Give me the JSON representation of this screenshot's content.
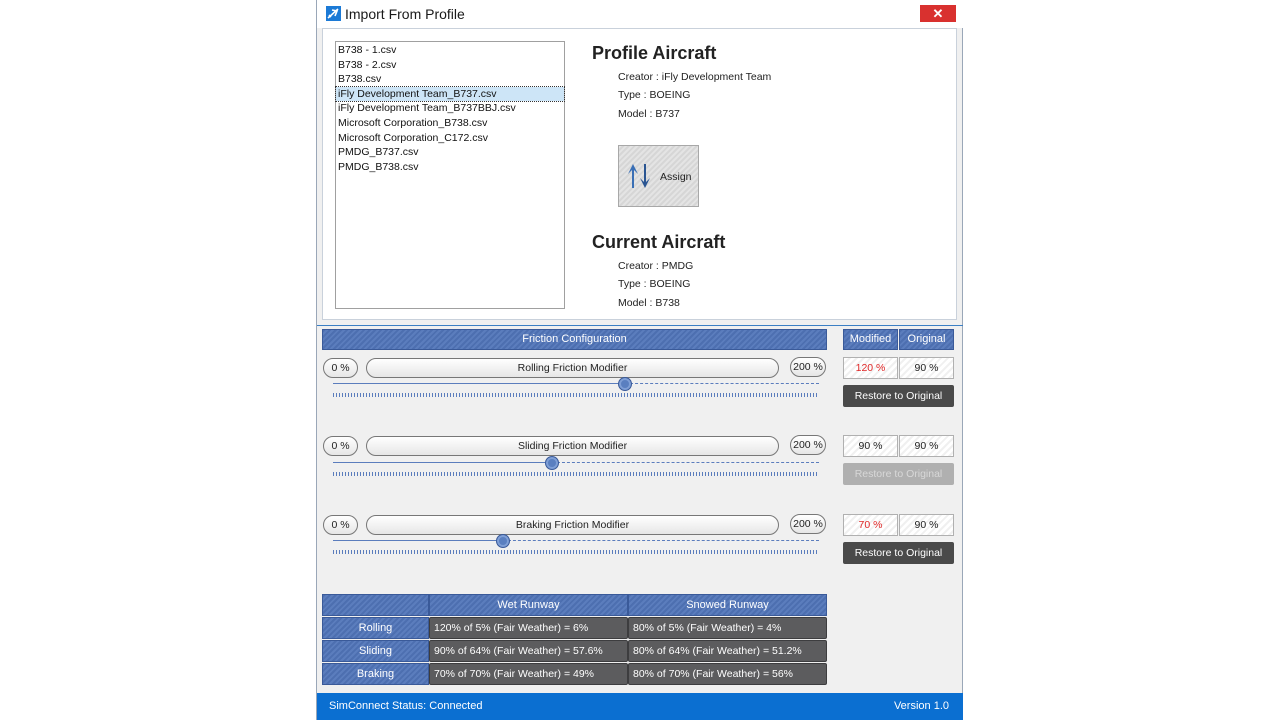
{
  "window": {
    "title": "Import From Profile",
    "close_label": "✕"
  },
  "file_list": {
    "items": [
      "B738 - 1.csv",
      "B738 - 2.csv",
      "B738.csv",
      "iFly Development Team_B737.csv",
      "iFly Development Team_B737BBJ.csv",
      "Microsoft Corporation_B738.csv",
      "Microsoft Corporation_C172.csv",
      "PMDG_B737.csv",
      "PMDG_B738.csv"
    ],
    "selected": 3
  },
  "profile_aircraft": {
    "title": "Profile Aircraft",
    "creator": "Creator : iFly Development Team",
    "type": "Type : BOEING",
    "model": "Model : B737"
  },
  "assign_button": {
    "label": "Assign"
  },
  "current_aircraft": {
    "title": "Current Aircraft",
    "creator": "Creator : PMDG",
    "type": "Type : BOEING",
    "model": "Model : B738"
  },
  "friction": {
    "header": "Friction Configuration",
    "col_modified": "Modified",
    "col_original": "Original",
    "min_label": "0 %",
    "max_label": "200 %",
    "restore_label": "Restore to Original",
    "rows": [
      {
        "label": "Rolling Friction Modifier",
        "modified": "120 %",
        "original": "90 %",
        "slider_percent": 120,
        "restore_enabled": true
      },
      {
        "label": "Sliding Friction Modifier",
        "modified": "90 %",
        "original": "90 %",
        "slider_percent": 90,
        "restore_enabled": false
      },
      {
        "label": "Braking Friction Modifier",
        "modified": "70 %",
        "original": "90 %",
        "slider_percent": 70,
        "restore_enabled": true
      }
    ]
  },
  "runway_table": {
    "headers": [
      "",
      "Wet Runway",
      "Snowed Runway"
    ],
    "rows": [
      {
        "label": "Rolling",
        "wet": "120% of 5% (Fair Weather) = 6%",
        "snow": "80% of 5% (Fair Weather) = 4%"
      },
      {
        "label": "Sliding",
        "wet": "90% of 64% (Fair Weather) = 57.6%",
        "snow": "80% of 64% (Fair Weather) = 51.2%"
      },
      {
        "label": "Braking",
        "wet": "70% of 70% (Fair Weather) = 49%",
        "snow": "80% of 70% (Fair Weather) = 56%"
      }
    ]
  },
  "status": {
    "text": "SimConnect Status: Connected",
    "version": "Version 1.0"
  },
  "colors": {
    "accent": "#0b6fd1",
    "header": "#5b7dbd",
    "modified_highlight": "#e02828",
    "cell_bg": "#5c5c5e"
  }
}
